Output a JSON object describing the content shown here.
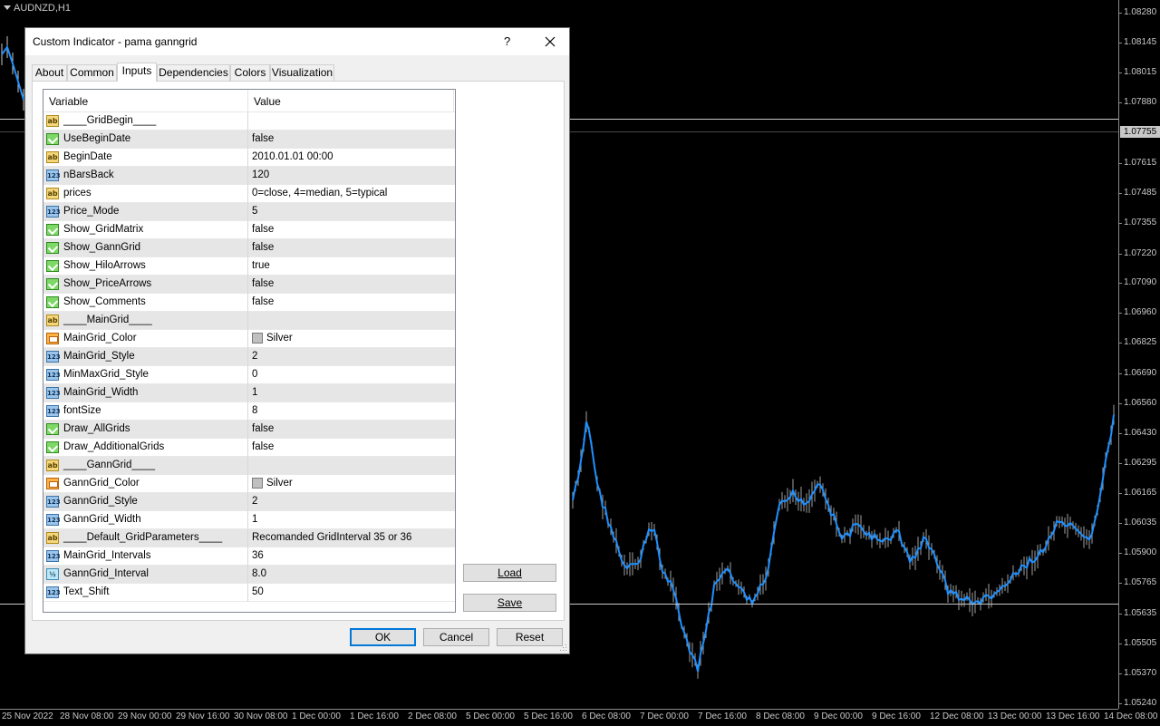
{
  "chart": {
    "symbol": "AUDNZD,H1",
    "price_ticks": [
      "1.08280",
      "1.08145",
      "1.08015",
      "1.07880",
      "1.07615",
      "1.07485",
      "1.07355",
      "1.07220",
      "1.07090",
      "1.06960",
      "1.06825",
      "1.06690",
      "1.06560",
      "1.06430",
      "1.06295",
      "1.06165",
      "1.06035",
      "1.05900",
      "1.05765",
      "1.05635",
      "1.05505",
      "1.05370",
      "1.05240"
    ],
    "current_price": "1.07755",
    "time_ticks": [
      "25 Nov 2022",
      "28 Nov 08:00",
      "29 Nov 00:00",
      "29 Nov 16:00",
      "30 Nov 08:00",
      "1 Dec 00:00",
      "1 Dec 16:00",
      "2 Dec 08:00",
      "5 Dec 00:00",
      "5 Dec 16:00",
      "6 Dec 08:00",
      "7 Dec 00:00",
      "7 Dec 16:00",
      "8 Dec 08:00",
      "9 Dec 00:00",
      "9 Dec 16:00",
      "12 Dec 08:00",
      "13 Dec 00:00",
      "13 Dec 16:00",
      "14 Dec 08:00"
    ],
    "colors": {
      "background": "#000000",
      "candles": "#c8c8c8",
      "indicator": "#1e90ff",
      "axis_text": "#c8c8c8"
    }
  },
  "dialog": {
    "title": "Custom Indicator - pama ganngrid",
    "help_label": "?",
    "tabs": [
      {
        "label": "About"
      },
      {
        "label": "Common"
      },
      {
        "label": "Inputs"
      },
      {
        "label": "Dependencies"
      },
      {
        "label": "Colors"
      },
      {
        "label": "Visualization"
      }
    ],
    "active_tab": "Inputs",
    "columns": {
      "variable": "Variable",
      "value": "Value"
    },
    "inputs": [
      {
        "icon": "string-type-icon",
        "name": "____GridBegin____",
        "value": ""
      },
      {
        "icon": "bool-type-icon",
        "name": "UseBeginDate",
        "value": "false"
      },
      {
        "icon": "string-type-icon",
        "name": "BeginDate",
        "value": "2010.01.01 00:00"
      },
      {
        "icon": "int-type-icon",
        "name": "nBarsBack",
        "value": "120"
      },
      {
        "icon": "string-type-icon",
        "name": "prices",
        "value": "0=close, 4=median, 5=typical"
      },
      {
        "icon": "int-type-icon",
        "name": "Price_Mode",
        "value": "5"
      },
      {
        "icon": "bool-type-icon",
        "name": "Show_GridMatrix",
        "value": "false"
      },
      {
        "icon": "bool-type-icon",
        "name": "Show_GannGrid",
        "value": "false"
      },
      {
        "icon": "bool-type-icon",
        "name": "Show_HiloArrows",
        "value": "true"
      },
      {
        "icon": "bool-type-icon",
        "name": "Show_PriceArrows",
        "value": "false"
      },
      {
        "icon": "bool-type-icon",
        "name": "Show_Comments",
        "value": "false"
      },
      {
        "icon": "string-type-icon",
        "name": "____MainGrid____",
        "value": ""
      },
      {
        "icon": "color-type-icon",
        "name": "MainGrid_Color",
        "value": "Silver",
        "swatch": "#c0c0c0"
      },
      {
        "icon": "int-type-icon",
        "name": "MainGrid_Style",
        "value": "2"
      },
      {
        "icon": "int-type-icon",
        "name": "MinMaxGrid_Style",
        "value": "0"
      },
      {
        "icon": "int-type-icon",
        "name": "MainGrid_Width",
        "value": "1"
      },
      {
        "icon": "int-type-icon",
        "name": "fontSize",
        "value": "8"
      },
      {
        "icon": "bool-type-icon",
        "name": "Draw_AllGrids",
        "value": "false"
      },
      {
        "icon": "bool-type-icon",
        "name": "Draw_AdditionalGrids",
        "value": "false"
      },
      {
        "icon": "string-type-icon",
        "name": "____GannGrid____",
        "value": ""
      },
      {
        "icon": "color-type-icon",
        "name": "GannGrid_Color",
        "value": "Silver",
        "swatch": "#c0c0c0"
      },
      {
        "icon": "int-type-icon",
        "name": "GannGrid_Style",
        "value": "2"
      },
      {
        "icon": "int-type-icon",
        "name": "GannGrid_Width",
        "value": "1"
      },
      {
        "icon": "string-type-icon",
        "name": "____Default_GridParameters____",
        "value": "Recomanded GridInterval 35 or 36"
      },
      {
        "icon": "int-type-icon",
        "name": "MainGrid_Intervals",
        "value": "36"
      },
      {
        "icon": "double-type-icon",
        "name": "GannGrid_Interval",
        "value": "8.0"
      },
      {
        "icon": "int-type-icon",
        "name": "Text_Shift",
        "value": "50"
      }
    ],
    "buttons": {
      "load": "Load",
      "save": "Save",
      "ok": "OK",
      "cancel": "Cancel",
      "reset": "Reset"
    }
  }
}
